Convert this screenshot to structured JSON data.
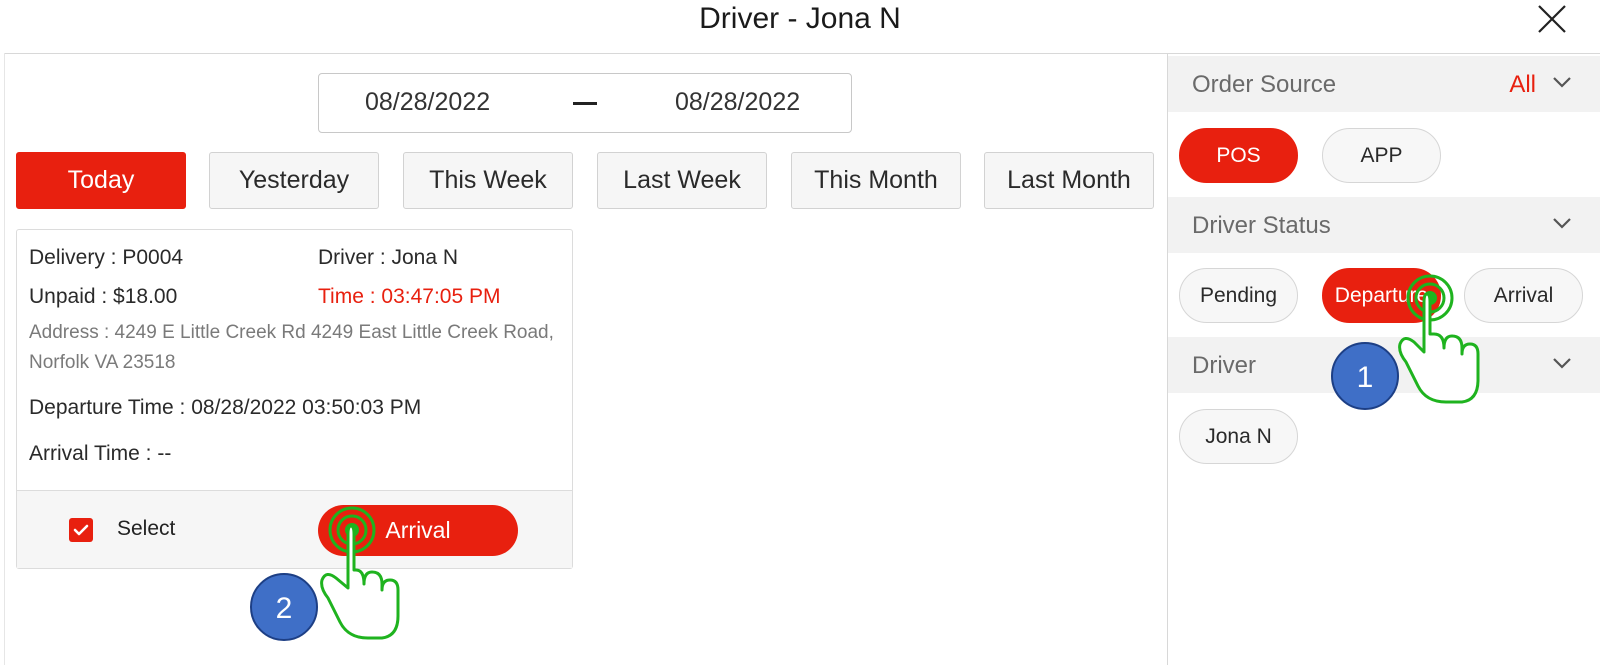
{
  "header": {
    "title": "Driver - Jona N"
  },
  "date_range": {
    "start": "08/28/2022",
    "end": "08/28/2022"
  },
  "quick_filters": [
    {
      "label": "Today",
      "active": true
    },
    {
      "label": "Yesterday",
      "active": false
    },
    {
      "label": "This Week",
      "active": false
    },
    {
      "label": "Last Week",
      "active": false
    },
    {
      "label": "This Month",
      "active": false
    },
    {
      "label": "Last Month",
      "active": false
    }
  ],
  "order_card": {
    "delivery": "Delivery  :  P0004",
    "driver": "Driver  :  Jona N",
    "unpaid": "Unpaid  :  $18.00",
    "time": "Time  :  03:47:05 PM",
    "address": "Address  :  4249 E Little Creek Rd 4249 East Little Creek Road, Norfolk VA 23518",
    "departure_time": "Departure Time  :  08/28/2022 03:50:03 PM",
    "arrival_time": "Arrival Time  :  --",
    "select_label": "Select",
    "select_checked": true,
    "action_label": "Arrival"
  },
  "filters": {
    "order_source": {
      "label": "Order Source",
      "value": "All",
      "options": [
        "POS",
        "APP"
      ],
      "selected": "POS"
    },
    "driver_status": {
      "label": "Driver Status",
      "options": [
        "Pending",
        "Departure",
        "Arrival"
      ],
      "selected": "Departure"
    },
    "driver": {
      "label": "Driver",
      "options": [
        "Jona N"
      ]
    }
  },
  "annotations": {
    "step1": "1",
    "step2": "2"
  },
  "colors": {
    "accent": "#e8200f",
    "badge": "#3f6fc7",
    "hand": "#1fb31f"
  }
}
